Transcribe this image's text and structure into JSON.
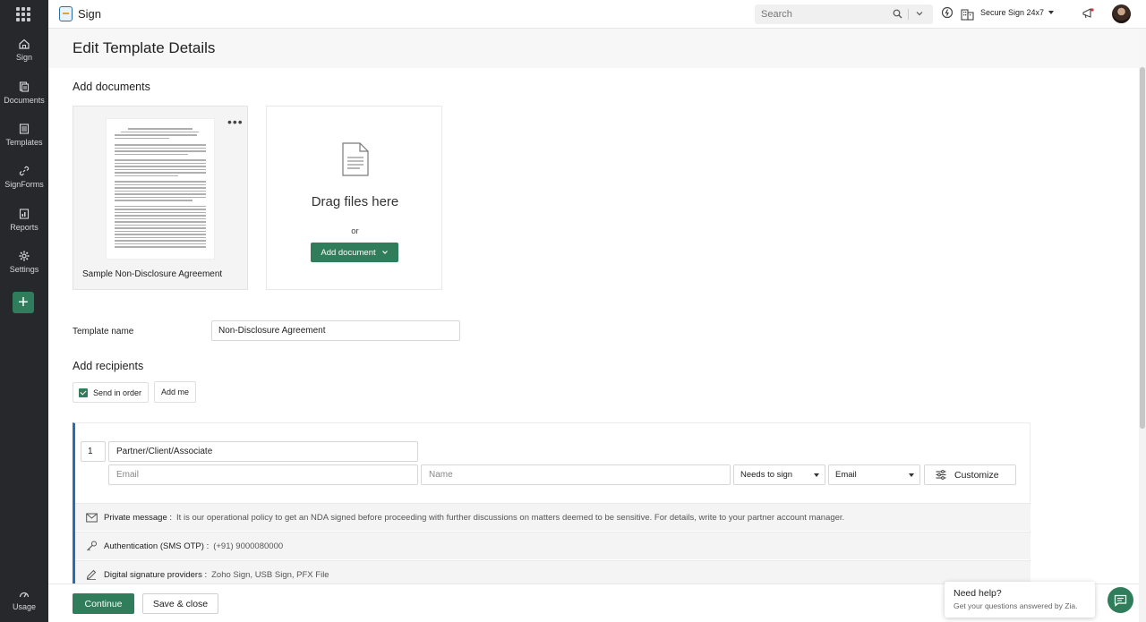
{
  "app": {
    "name": "Sign"
  },
  "topbar": {
    "search_placeholder": "Search",
    "org_name": "Secure Sign 24x7"
  },
  "sidebar": {
    "items": [
      {
        "label": "Sign",
        "icon": "home-icon"
      },
      {
        "label": "Documents",
        "icon": "documents-icon"
      },
      {
        "label": "Templates",
        "icon": "templates-icon"
      },
      {
        "label": "SignForms",
        "icon": "link-icon"
      },
      {
        "label": "Reports",
        "icon": "reports-icon"
      },
      {
        "label": "Settings",
        "icon": "gear-icon"
      }
    ],
    "usage_label": "Usage"
  },
  "page": {
    "title": "Edit Template Details",
    "add_documents_title": "Add documents",
    "document_name": "Sample Non-Disclosure Agreement",
    "drag_text": "Drag files here",
    "or_text": "or",
    "add_document_label": "Add document",
    "template_name_label": "Template name",
    "template_name_value": "Non-Disclosure Agreement",
    "add_recipients_title": "Add recipients",
    "send_in_order_label": "Send in order",
    "add_me_label": "Add me"
  },
  "recipient": {
    "order": "1",
    "role": "Partner/Client/Associate",
    "email_placeholder": "Email",
    "name_placeholder": "Name",
    "action": "Needs to sign",
    "delivery": "Email",
    "customize_label": "Customize",
    "private_message_label": "Private message :",
    "private_message_value": "It is our operational policy to get an NDA signed before proceeding with further discussions on matters deemed to be sensitive. For details, write to your partner account manager.",
    "auth_label": "Authentication (SMS OTP) :",
    "auth_value": "(+91) 9000080000",
    "dsp_label": "Digital signature providers :",
    "dsp_value": "Zoho Sign, USB Sign, PFX File"
  },
  "footer": {
    "continue_label": "Continue",
    "save_close_label": "Save & close"
  },
  "help": {
    "title": "Need help?",
    "subtitle": "Get your questions answered by Zia."
  },
  "colors": {
    "primary_green": "#2f7d5a",
    "sidebar_bg": "#26282c",
    "accent_blue": "#2b6cb0"
  }
}
